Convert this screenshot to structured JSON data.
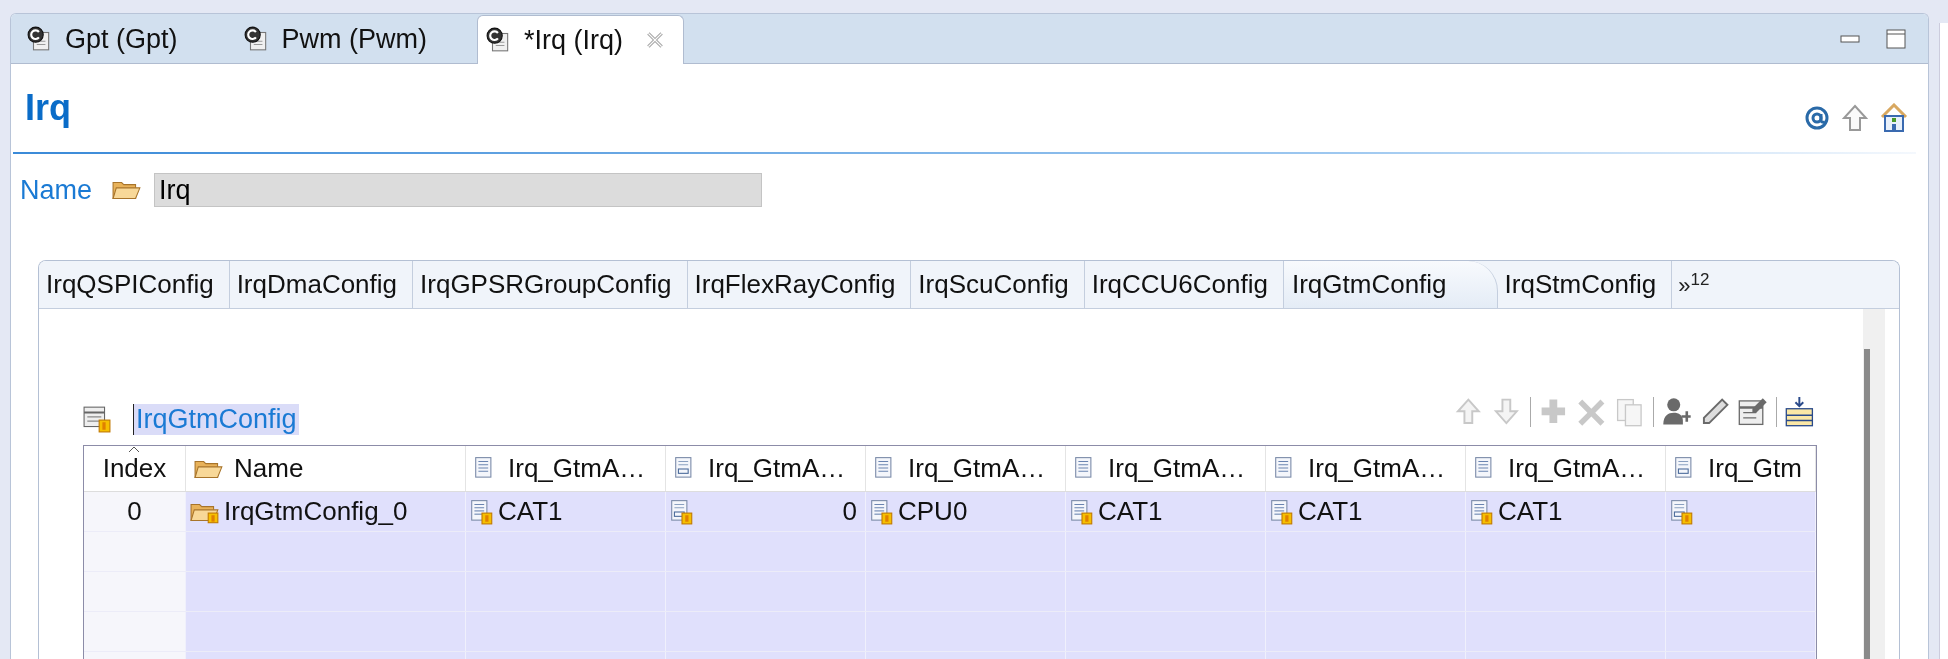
{
  "editor_tabs": [
    {
      "label": "Gpt (Gpt)",
      "selected": false
    },
    {
      "label": "Pwm (Pwm)",
      "selected": false
    },
    {
      "label": "*Irq (Irq)",
      "selected": true
    }
  ],
  "page": {
    "title": "Irq"
  },
  "name_field": {
    "label": "Name",
    "value": "Irq"
  },
  "config_tabs": [
    {
      "label": "IrqQSPIConfig",
      "selected": false
    },
    {
      "label": "IrqDmaConfig",
      "selected": false
    },
    {
      "label": "IrqGPSRGroupConfig",
      "selected": false
    },
    {
      "label": "IrqFlexRayConfig",
      "selected": false
    },
    {
      "label": "IrqScuConfig",
      "selected": false
    },
    {
      "label": "IrqCCU6Config",
      "selected": false
    },
    {
      "label": "IrqGtmConfig",
      "selected": true
    },
    {
      "label": "IrqStmConfig",
      "selected": false
    }
  ],
  "overflow": {
    "chevron": "»",
    "count": "12"
  },
  "table": {
    "title": "IrqGtmConfig",
    "toolbar": [
      {
        "kind": "up",
        "disabled": true
      },
      {
        "kind": "down",
        "disabled": true
      },
      {
        "kind": "add",
        "disabled": true
      },
      {
        "kind": "delete",
        "disabled": true
      },
      {
        "kind": "copy",
        "disabled": true
      },
      {
        "kind": "user",
        "disabled": false
      },
      {
        "kind": "pencil",
        "disabled": false
      },
      {
        "kind": "edit",
        "disabled": false
      },
      {
        "kind": "insert",
        "disabled": false
      }
    ],
    "columns": [
      {
        "label": "Index",
        "kind": "index"
      },
      {
        "label": "Name",
        "kind": "folder"
      },
      {
        "label": "Irq_GtmA…",
        "kind": "text"
      },
      {
        "label": "Irq_GtmA…",
        "kind": "number"
      },
      {
        "label": "Irq_GtmA…",
        "kind": "text"
      },
      {
        "label": "Irq_GtmA…",
        "kind": "text"
      },
      {
        "label": "Irq_GtmA…",
        "kind": "text"
      },
      {
        "label": "Irq_GtmA…",
        "kind": "text"
      },
      {
        "label": "Irq_Gtm",
        "kind": "number"
      }
    ],
    "rows": [
      {
        "cells": [
          {
            "kind": "index",
            "value": "0"
          },
          {
            "kind": "folder",
            "value": "IrqGtmConfig_0"
          },
          {
            "kind": "text",
            "value": "CAT1"
          },
          {
            "kind": "number",
            "value": "0"
          },
          {
            "kind": "text",
            "value": "CPU0"
          },
          {
            "kind": "text",
            "value": "CAT1"
          },
          {
            "kind": "text",
            "value": "CAT1"
          },
          {
            "kind": "text",
            "value": "CAT1"
          },
          {
            "kind": "number"
          }
        ]
      }
    ]
  }
}
